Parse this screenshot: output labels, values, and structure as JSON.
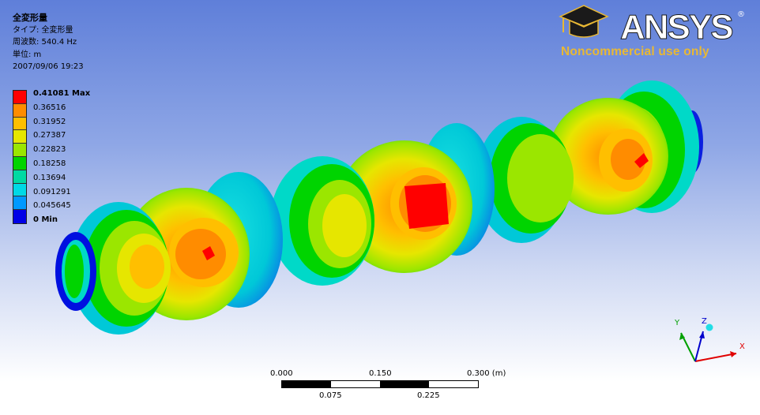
{
  "info": {
    "title": "全変形量",
    "type": "タイプ: 全変形量",
    "frequency": "周波数: 540.4 Hz",
    "unit": "単位: m",
    "date": "2007/09/06 19:23"
  },
  "legend": {
    "entries": [
      {
        "label": "0.41081  Max",
        "color": "#ff0000"
      },
      {
        "label": "0.36516",
        "color": "#ff8c00"
      },
      {
        "label": "0.31952",
        "color": "#ffbf00"
      },
      {
        "label": "0.27387",
        "color": "#e6e600"
      },
      {
        "label": "0.22823",
        "color": "#9be600"
      },
      {
        "label": "0.18258",
        "color": "#00d400"
      },
      {
        "label": "0.13694",
        "color": "#00d9a3"
      },
      {
        "label": "0.091291",
        "color": "#00d9e6"
      },
      {
        "label": "0.045645",
        "color": "#0099ff"
      },
      {
        "label": "0  Min",
        "color": "#0000e6"
      }
    ]
  },
  "logo": {
    "brand": "ANSYS",
    "tagline": "Noncommercial use only",
    "brand_color": "#ffffff",
    "tagline_color": "#e8b834"
  },
  "scale_bar": {
    "top_labels": [
      "0.000",
      "0.150",
      "0.300 (m)"
    ],
    "bottom_labels": [
      "0.075",
      "0.225"
    ]
  },
  "triad": {
    "x": "X",
    "y": "Y",
    "z": "Z"
  }
}
